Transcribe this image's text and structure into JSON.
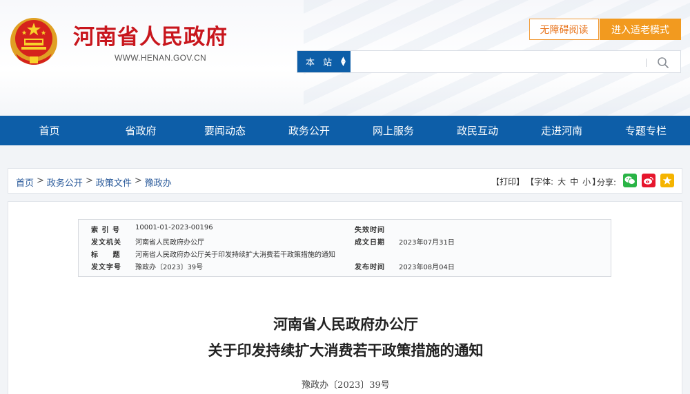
{
  "header": {
    "site_title": "河南省人民政府",
    "site_url": "WWW.HENAN.GOV.CN",
    "accessibility_label": "无障碍阅读",
    "elder_mode_label": "进入适老模式",
    "search": {
      "scope_label": "本 站",
      "placeholder": ""
    }
  },
  "nav": {
    "items": [
      {
        "label": "首页"
      },
      {
        "label": "省政府"
      },
      {
        "label": "要闻动态"
      },
      {
        "label": "政务公开"
      },
      {
        "label": "网上服务"
      },
      {
        "label": "政民互动"
      },
      {
        "label": "走进河南"
      },
      {
        "label": "专题专栏"
      }
    ]
  },
  "breadcrumb": {
    "items": [
      "首页",
      "政务公开",
      "政策文件",
      "豫政办"
    ],
    "separator": ">"
  },
  "tools": {
    "print": "【打印】",
    "font_label": "【字体:",
    "font_large": "大",
    "font_medium": "中",
    "font_small": "小",
    "font_close": "】",
    "share_label": "分享:"
  },
  "meta": {
    "index_label": "索 引 号",
    "index_value": "10001-01-2023-00196",
    "issuer_label": "发文机关",
    "issuer_value": "河南省人民政府办公厅",
    "title_label": "标 题",
    "title_value": "河南省人民政府办公厅关于印发持续扩大消费若干政策措施的通知",
    "doc_no_label": "发文字号",
    "doc_no_value": "豫政办〔2023〕39号",
    "expire_label": "失效时间",
    "expire_value": "",
    "written_label": "成文日期",
    "written_value": "2023年07月31日",
    "publish_label": "发布时间",
    "publish_value": "2023年08月04日"
  },
  "document": {
    "title_line1": "河南省人民政府办公厅",
    "title_line2": "关于印发持续扩大消费若干政策措施的通知",
    "number": "豫政办〔2023〕39号"
  },
  "colors": {
    "brand_red": "#c8161d",
    "nav_blue": "#0d5ea8",
    "orange": "#f29a1f",
    "wechat": "#2ab446",
    "weibo": "#e6162d",
    "favorite": "#f5b400"
  }
}
